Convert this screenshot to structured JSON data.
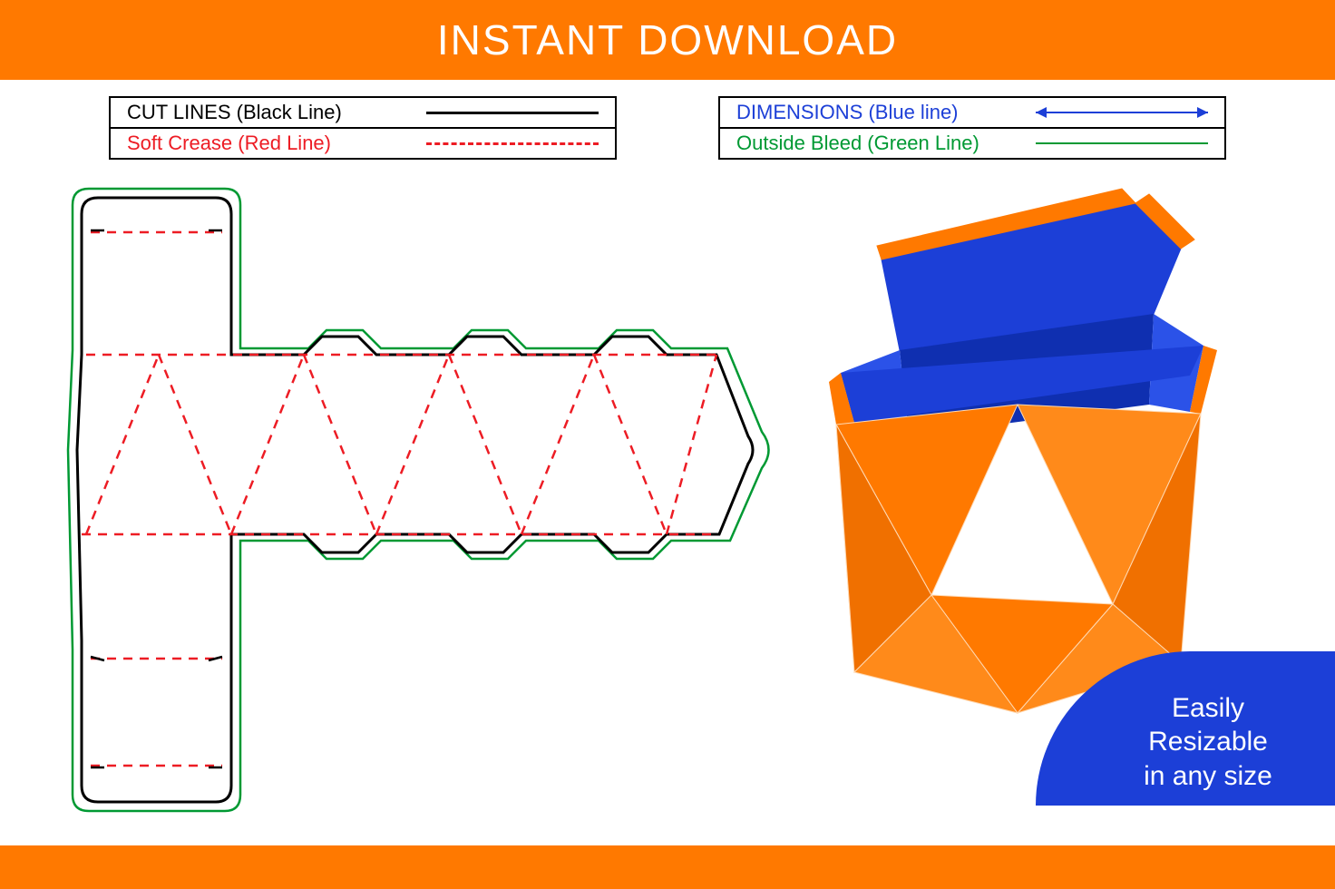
{
  "header": {
    "title": "INSTANT DOWNLOAD"
  },
  "legend": {
    "left": [
      {
        "label": "CUT LINES (Black Line)",
        "style": "black"
      },
      {
        "label": "Soft Crease (Red Line)",
        "style": "red"
      }
    ],
    "right": [
      {
        "label": "DIMENSIONS (Blue line)",
        "style": "blue"
      },
      {
        "label": "Outside Bleed (Green Line)",
        "style": "green"
      }
    ]
  },
  "badge": {
    "line1": "Easily",
    "line2": "Resizable",
    "line3": "in any size"
  },
  "colors": {
    "orange": "#ff7900",
    "blue": "#1c3fd7",
    "red": "#ed1c24",
    "green": "#009933",
    "black": "#000000"
  },
  "diagram": {
    "type": "dieline-template",
    "description": "Flat dieline for a faceted geometric box with triangular panels, plus 3D mockup of assembled box",
    "components": [
      "cut-lines",
      "fold-creases",
      "bleed-outline",
      "top-flap",
      "bottom-flap",
      "triangular-body-panels",
      "3d-assembled-preview"
    ]
  }
}
